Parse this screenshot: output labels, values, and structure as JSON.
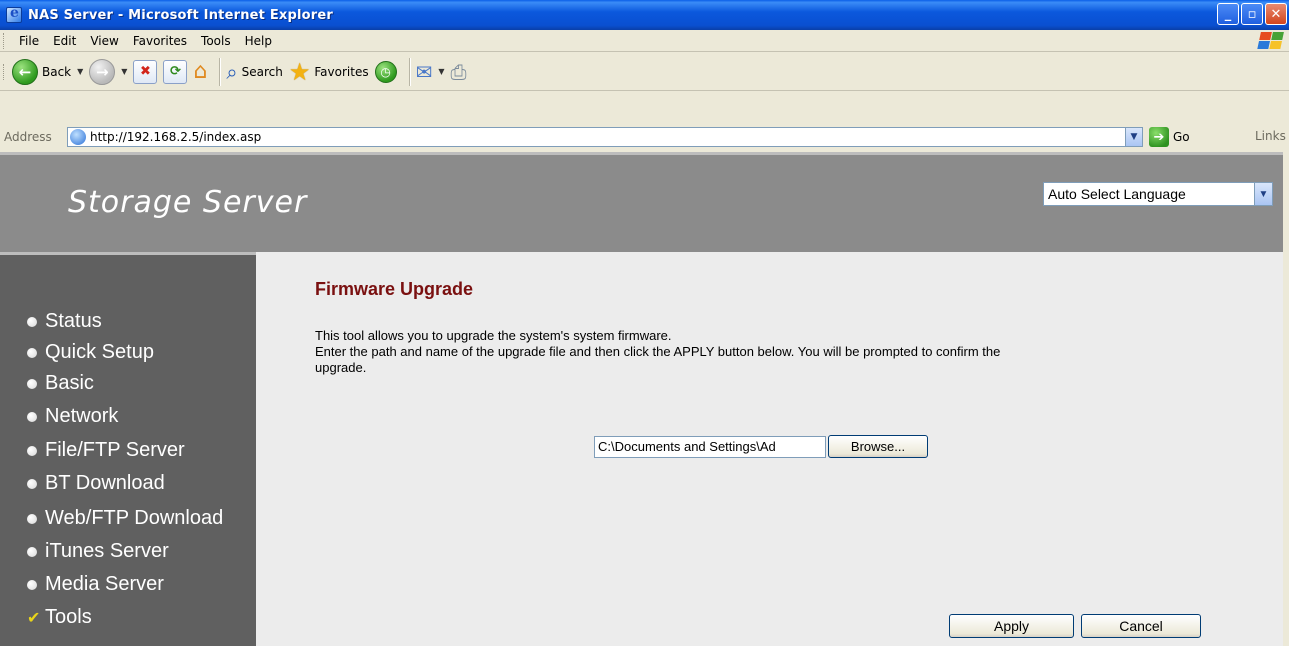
{
  "window": {
    "title": "NAS Server - Microsoft Internet Explorer",
    "buttons": {
      "minimize": "_",
      "maximize": "▫",
      "close": "✕"
    }
  },
  "menu": [
    "File",
    "Edit",
    "View",
    "Favorites",
    "Tools",
    "Help"
  ],
  "toolbar": {
    "back_label": "Back",
    "search_label": "Search",
    "favorites_label": "Favorites"
  },
  "address": {
    "label": "Address",
    "url": "http://192.168.2.5/index.asp",
    "go_label": "Go",
    "links_label": "Links"
  },
  "banner": {
    "title": "Storage Server",
    "language_selected": "Auto Select Language"
  },
  "sidebar": {
    "items": [
      {
        "label": "Status",
        "marker": "bullet"
      },
      {
        "label": "Quick Setup",
        "marker": "bullet"
      },
      {
        "label": "Basic",
        "marker": "bullet"
      },
      {
        "label": "Network",
        "marker": "bullet"
      },
      {
        "label": "File/FTP Server",
        "marker": "bullet"
      },
      {
        "label": "BT Download",
        "marker": "bullet"
      },
      {
        "label": "Web/FTP Download",
        "marker": "bullet"
      },
      {
        "label": "iTunes Server",
        "marker": "bullet"
      },
      {
        "label": "Media Server",
        "marker": "bullet"
      },
      {
        "label": "Tools",
        "marker": "check"
      }
    ]
  },
  "main": {
    "heading": "Firmware Upgrade",
    "desc_line1": "This tool allows you to upgrade the system's system firmware.",
    "desc_line2": "Enter the path and name of the upgrade file and then click the APPLY button below. You will be prompted to confirm the",
    "desc_line3": "upgrade.",
    "file_path": "C:\\Documents and Settings\\Ad",
    "browse_label": "Browse...",
    "apply_label": "Apply",
    "cancel_label": "Cancel"
  },
  "colors": {
    "title_bar": "#0a4fd0",
    "banner": "#8b8b8b",
    "sidebar": "#606060",
    "heading": "#7a1010",
    "content_bg": "#ececec"
  }
}
